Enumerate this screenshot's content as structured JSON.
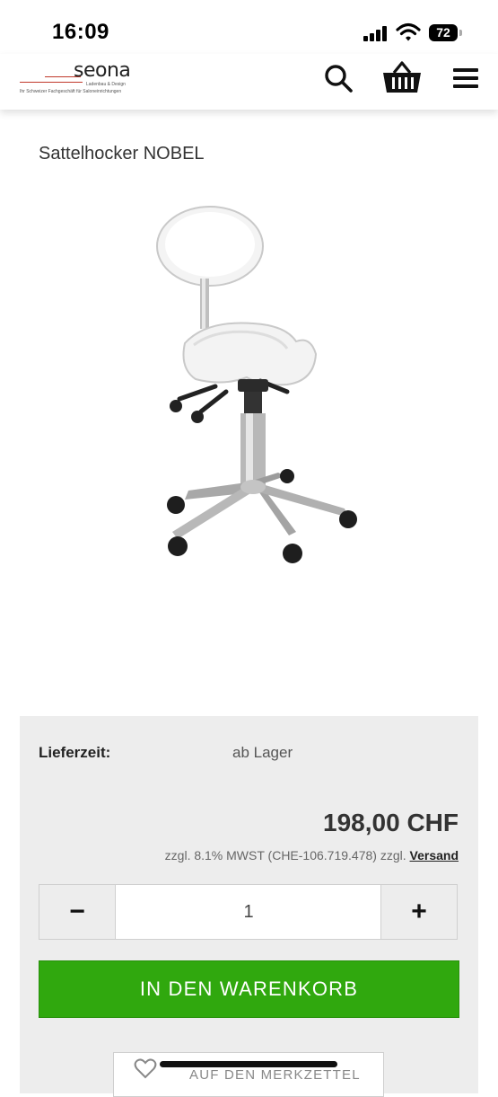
{
  "status_bar": {
    "time": "16:09",
    "battery": "72",
    "icons": [
      "signal-icon",
      "wifi-icon",
      "battery-icon"
    ]
  },
  "header": {
    "logo_text": "seona",
    "logo_subline": "Ladenbau & Design",
    "logo_tagline": "Ihr Schweizer Fachgeschäft für Saloneinrichtungen",
    "icons": [
      "search-icon",
      "basket-icon",
      "menu-icon"
    ]
  },
  "product": {
    "title": "Sattelhocker NOBEL",
    "image_icon": "saddle-stool-image"
  },
  "buybox": {
    "delivery_label": "Lieferzeit:",
    "delivery_value": "ab Lager",
    "price": "198,00 CHF",
    "tax_note": "zzgl. 8.1% MWST (CHE-106.719.478) zzgl.",
    "shipping_link": "Versand",
    "quantity_minus": "−",
    "quantity_value": "1",
    "quantity_plus": "+",
    "add_to_cart": "IN DEN WARENKORB",
    "wishlist": "AUF DEN MERKZETTEL"
  },
  "colors": {
    "cart_button": "#30a80e",
    "box_background": "#ededed",
    "logo_accent": "#c0392b"
  }
}
